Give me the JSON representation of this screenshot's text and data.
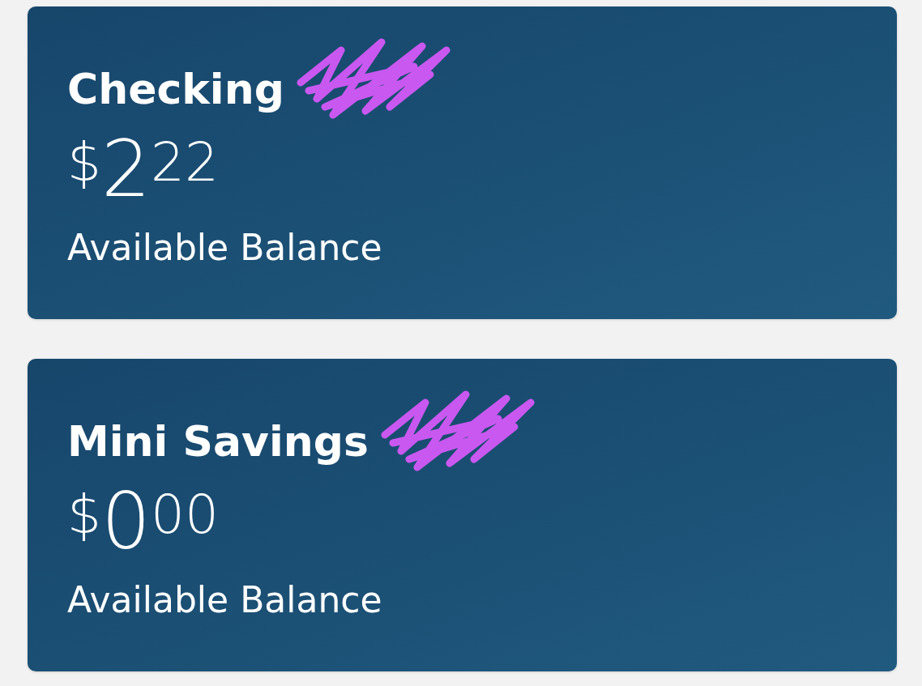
{
  "accounts": [
    {
      "name": "Checking",
      "redacted": true,
      "currency": "$",
      "whole": "2",
      "cents": "22",
      "caption": "Available Balance"
    },
    {
      "name": "Mini Savings",
      "redacted": true,
      "currency": "$",
      "whole": "0",
      "cents": "00",
      "caption": "Available Balance"
    }
  ]
}
